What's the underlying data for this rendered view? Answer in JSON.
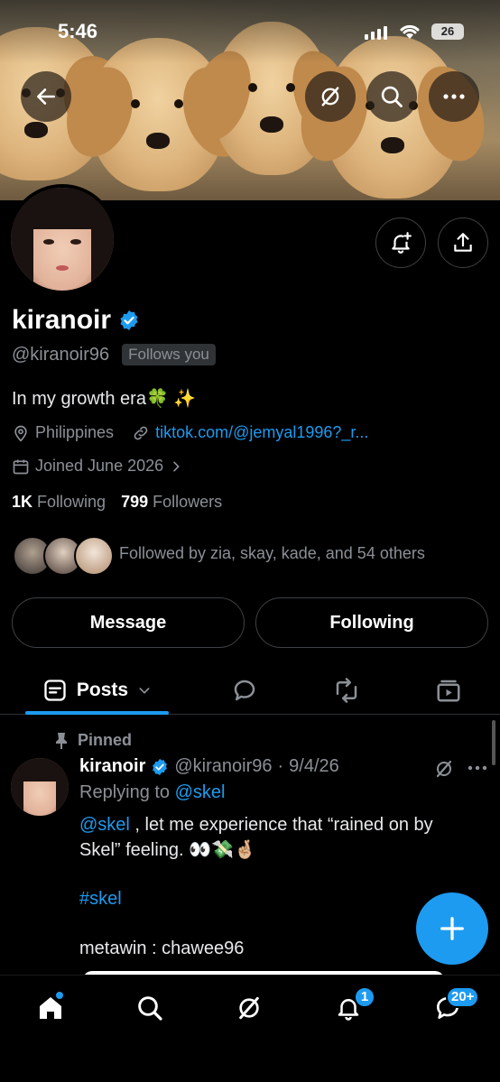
{
  "status_bar": {
    "time": "5:46",
    "battery": "26"
  },
  "profile": {
    "name": "kiranoir",
    "handle": "@kiranoir96",
    "follows_you": "Follows you",
    "bio": "In my growth era🍀 ✨",
    "location": "Philippines",
    "link": "tiktok.com/@jemyal1996?_r...",
    "joined": "Joined June 2026",
    "following_count": "1K",
    "following_label": "Following",
    "followers_count": "799",
    "followers_label": "Followers",
    "mutuals_text": "Followed by zia, skay, kade, and 54 others"
  },
  "actions": {
    "message": "Message",
    "following": "Following"
  },
  "tabs": {
    "posts": "Posts"
  },
  "post": {
    "pinned_label": "Pinned",
    "author_name": "kiranoir",
    "author_handle": "@kiranoir96",
    "date": "9/4/26",
    "replying_prefix": "Replying to ",
    "replying_to": "@skel",
    "mention": "@skel",
    "text_rest": " , let me experience that “rained on by Skel” feeling. 👀💸🤞🏼",
    "hashtag": "#skel",
    "line3": "metawin : chawee96"
  },
  "nav": {
    "notifications_badge": "1",
    "messages_badge": "20+"
  },
  "colors": {
    "accent": "#1d9bf0",
    "background": "#000000",
    "muted": "#8b9096"
  }
}
